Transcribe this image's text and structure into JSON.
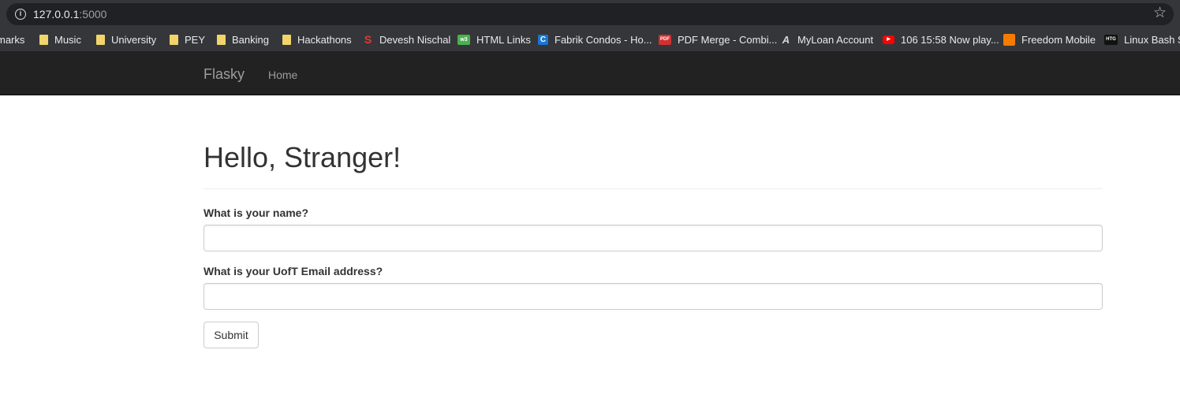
{
  "browser": {
    "url_host": "127.0.0.1",
    "url_port": ":5000",
    "bookmarks": [
      {
        "label": "marks",
        "icon": "none"
      },
      {
        "label": "Music",
        "icon": "folder-icon"
      },
      {
        "label": "University",
        "icon": "folder-icon"
      },
      {
        "label": "PEY",
        "icon": "folder-icon"
      },
      {
        "label": "Banking",
        "icon": "folder-icon"
      },
      {
        "label": "Hackathons",
        "icon": "folder-icon"
      },
      {
        "label": "Devesh Nischal",
        "icon": "devesh-logo-icon"
      },
      {
        "label": "HTML Links",
        "icon": "w3-logo-icon"
      },
      {
        "label": "Fabrik Condos - Ho...",
        "icon": "fabrik-logo-icon"
      },
      {
        "label": "PDF Merge - Combi...",
        "icon": "pdf-logo-icon"
      },
      {
        "label": "MyLoan Account",
        "icon": "myloan-logo-icon"
      },
      {
        "label": "106 15:58 Now play...",
        "icon": "youtube-icon"
      },
      {
        "label": "Freedom Mobile",
        "icon": "freedom-logo-icon"
      },
      {
        "label": "Linux Bash Sh",
        "icon": "htg-logo-icon"
      }
    ]
  },
  "navbar": {
    "brand": "Flasky",
    "links": [
      "Home"
    ],
    "background": "#222222",
    "text_color": "#9d9d9d"
  },
  "main": {
    "title": "Hello, Stranger!",
    "form": {
      "name_label": "What is your name?",
      "name_value": "",
      "email_label": "What is your UofT Email address?",
      "email_value": "",
      "submit_label": "Submit"
    }
  }
}
